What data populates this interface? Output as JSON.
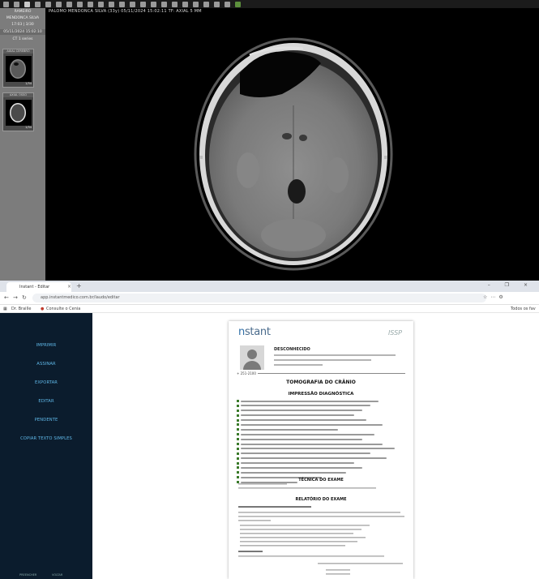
{
  "viewer": {
    "info": "PALOMO MENDONCA SILVA (33y)   05/11/2024 15:02:11   TF: AXIAL 5 MM",
    "panel_header_1": "RAMEIRO",
    "panel_header_2": "MENDONCA SILVA",
    "panel_header_3": "17:03 | 3/30",
    "panel_date": "05/11/2024  15:02:10",
    "panel_tab": "CT  1 series",
    "series": [
      {
        "label": "AXIAL CEREBRO",
        "count": "1/34"
      },
      {
        "label": "AXIAL OSSO",
        "count": "1/34"
      }
    ]
  },
  "browser": {
    "tab_title": "Instant - Editar",
    "tab_close": "×",
    "new_tab": "+",
    "window_controls": "– ❐ ×",
    "url": "app.instantmedico.com.br/laudo/editar",
    "bookmarks": [
      "Dr. Braille",
      "Consulte o Cenia"
    ],
    "bookmarks_right": "Todos os fav"
  },
  "menu": {
    "items": [
      "IMPRIMIR",
      "ASSINAR",
      "EXPORTAR",
      "EDITAR",
      "PENDENTE",
      "COPIAR TEXTO SIMPLES"
    ],
    "footer_left": "PREENCHER",
    "footer_right": "VOLTAR"
  },
  "document": {
    "logo_prefix": "n",
    "logo_rest": "stant",
    "logo_right": "ISSP",
    "patient_name": "DESCONHECIDO",
    "patient_id": "+  251-2100",
    "title": "TOMOGRAFIA DO CRÂNIO",
    "impression_heading": "IMPRESSÃO DIAGNÓSTICA",
    "impression_count": 18,
    "technique_heading": "TÉCNICA DO EXAME",
    "report_heading": "RELATÓRIO DO EXAME"
  },
  "colors": {
    "menu_bg": "#0b1c2d",
    "menu_text": "#5fb8e8",
    "viewer_panel": "#7c7c7c",
    "logo_blue": "#2f6fa8"
  }
}
